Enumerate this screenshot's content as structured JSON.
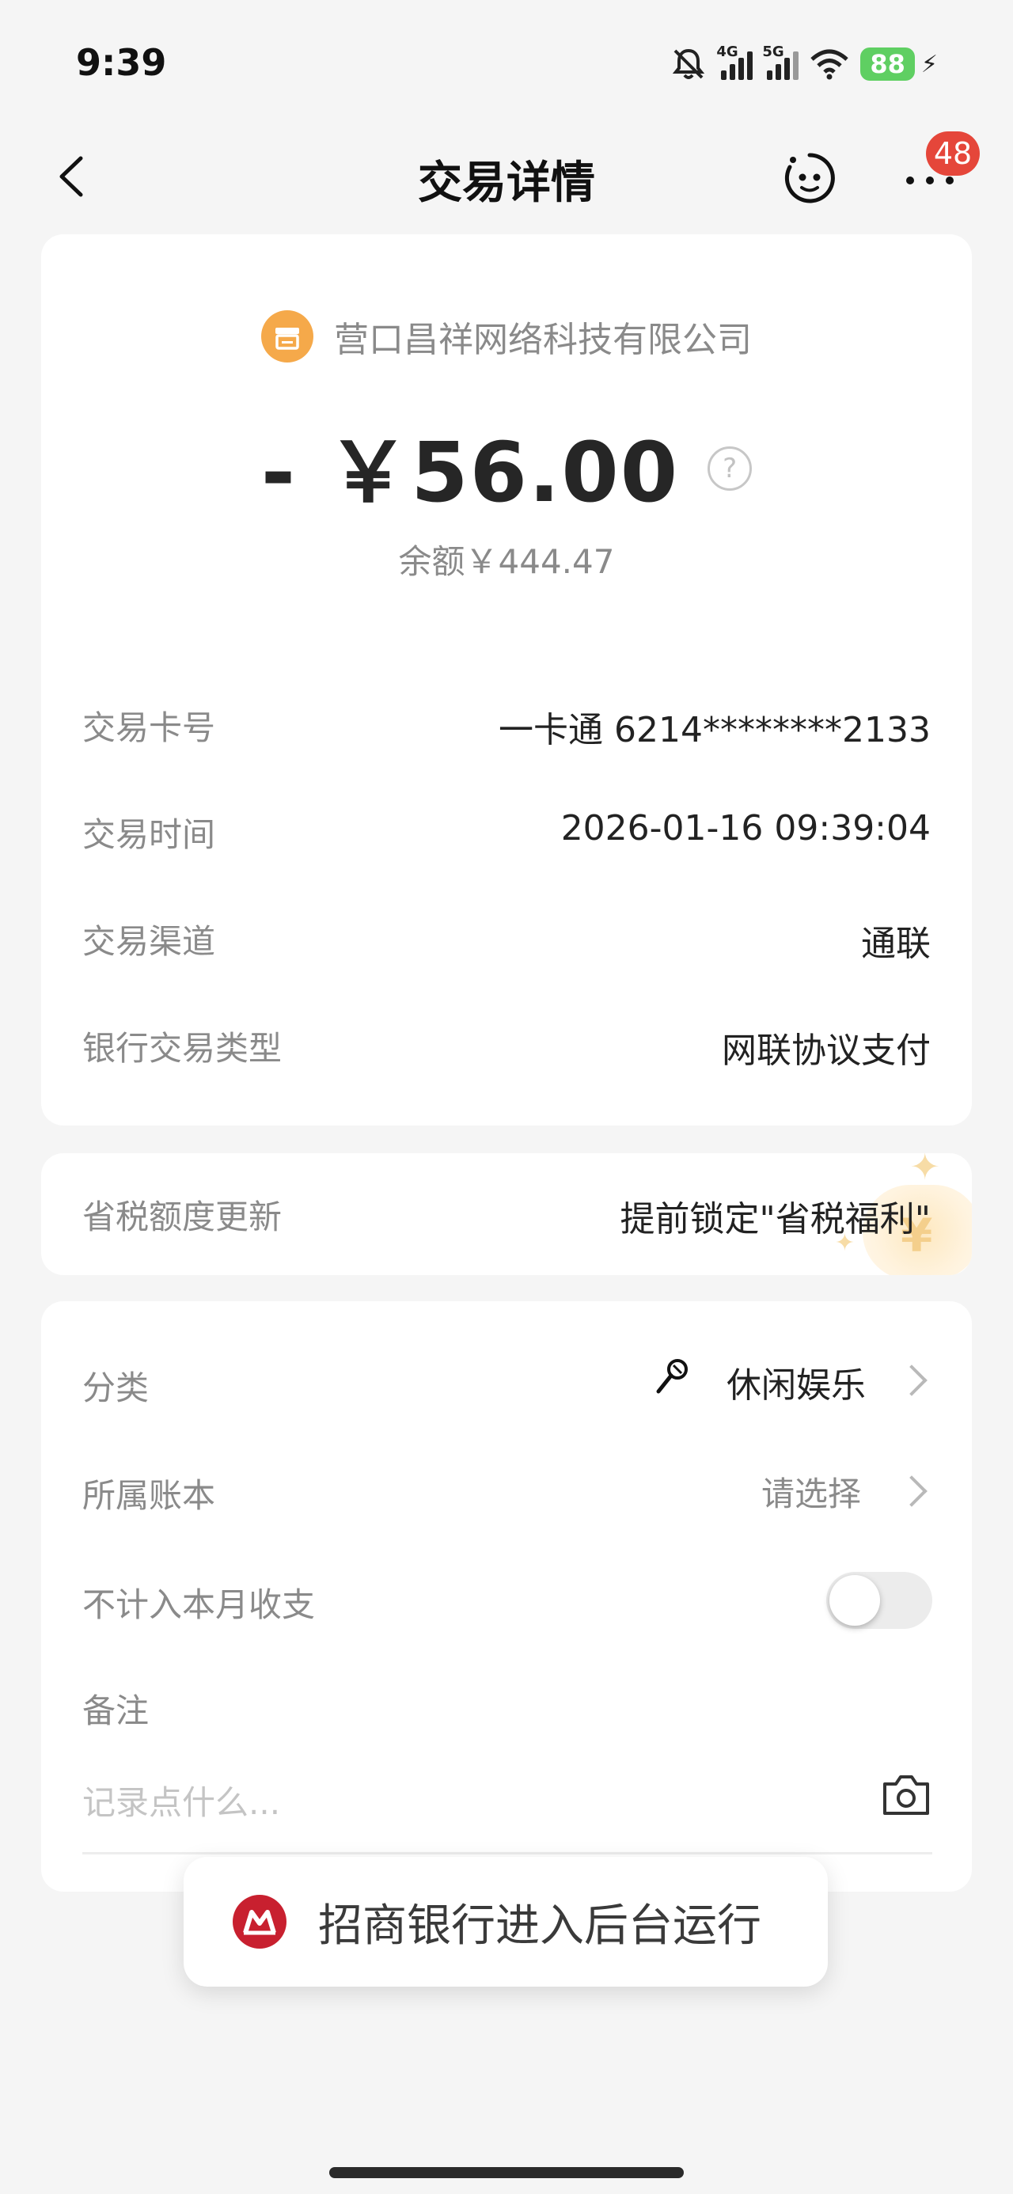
{
  "status_bar": {
    "time": "9:39",
    "net1": "4G",
    "net2": "5G",
    "battery": "88"
  },
  "nav": {
    "title": "交易详情",
    "badge": "48"
  },
  "transaction": {
    "merchant": "营口昌祥网络科技有限公司",
    "amount": "- ￥56.00",
    "help_icon": "?",
    "balance": "余额￥444.47"
  },
  "details": [
    {
      "label": "交易卡号",
      "value": "一卡通 6214********2133"
    },
    {
      "label": "交易时间",
      "value": "2026-01-16 09:39:04"
    },
    {
      "label": "交易渠道",
      "value": "通联"
    },
    {
      "label": "银行交易类型",
      "value": "网联协议支付"
    }
  ],
  "tax": {
    "label": "省税额度更新",
    "value": "提前锁定\"省税福利\"",
    "deco_symbol": "¥"
  },
  "classification": {
    "category_label": "分类",
    "category_value": "休闲娱乐",
    "book_label": "所属账本",
    "book_value": "请选择",
    "exclude_label": "不计入本月收支",
    "exclude_enabled": false,
    "note_label": "备注",
    "note_placeholder": "记录点什么..."
  },
  "toast": {
    "text": "招商银行进入后台运行"
  },
  "colors": {
    "accent_orange": "#f5a94a",
    "badge_red": "#e5463a",
    "bank_red": "#c8202f",
    "battery_green": "#5fcf62"
  },
  "icons": [
    "back-arrow-icon",
    "robot-face-icon",
    "more-dots-icon",
    "shop-icon",
    "help-icon",
    "microphone-icon",
    "chevron-right-icon",
    "camera-icon",
    "cmb-logo-icon"
  ]
}
